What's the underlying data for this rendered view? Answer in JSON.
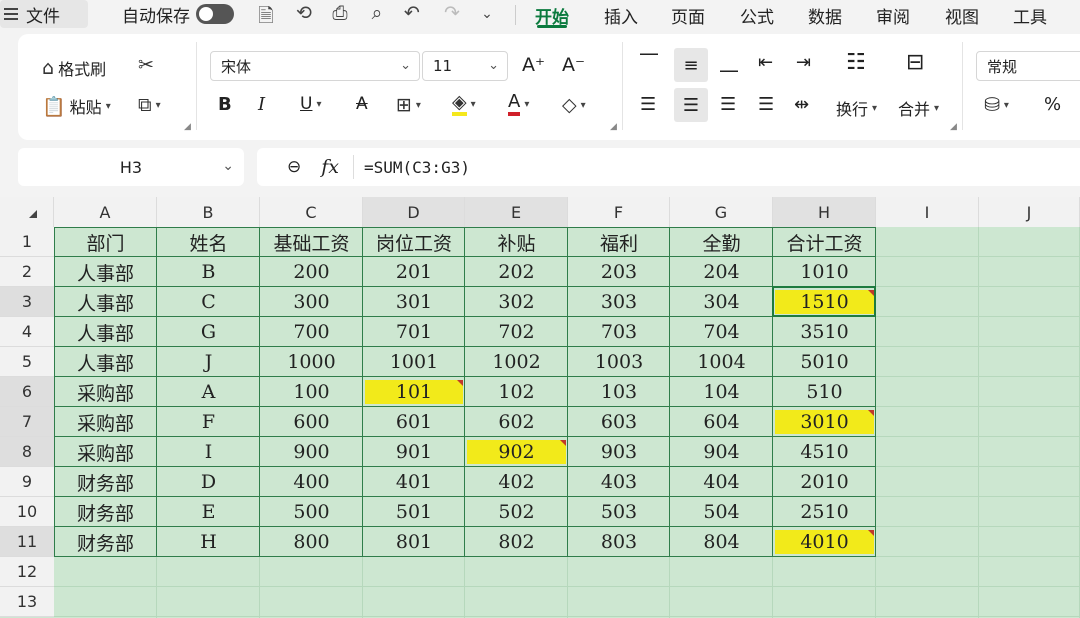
{
  "menubar": {
    "file": "文件",
    "autosave": "自动保存",
    "tabs": [
      "开始",
      "插入",
      "页面",
      "公式",
      "数据",
      "审阅",
      "视图",
      "工具"
    ],
    "active_tab": "开始"
  },
  "ribbon": {
    "format_painter": "格式刷",
    "paste": "粘贴",
    "font_name": "宋体",
    "font_size": "11",
    "wrap_text": "换行",
    "merge": "合并",
    "number_format": "常规",
    "percent": "%",
    "bold": "B",
    "italic": "I",
    "underline": "U",
    "font_color_letter": "A"
  },
  "formula_bar": {
    "name_box": "H3",
    "fx": "fx",
    "formula": "=SUM(C3:G3)"
  },
  "colors": {
    "accent": "#0b7a3e",
    "sheet_bg": "#cde7d1",
    "highlight": "#f2ea1a"
  },
  "sheet": {
    "columns": [
      "A",
      "B",
      "C",
      "D",
      "E",
      "F",
      "G",
      "H",
      "I",
      "J"
    ],
    "row_numbers": [
      "1",
      "2",
      "3",
      "4",
      "5",
      "6",
      "7",
      "8",
      "9",
      "10",
      "11",
      "12",
      "13"
    ],
    "selected_cell": "H3",
    "rows": [
      [
        "部门",
        "姓名",
        "基础工资",
        "岗位工资",
        "补贴",
        "福利",
        "全勤",
        "合计工资"
      ],
      [
        "人事部",
        "B",
        "200",
        "201",
        "202",
        "203",
        "204",
        "1010"
      ],
      [
        "人事部",
        "C",
        "300",
        "301",
        "302",
        "303",
        "304",
        "1510"
      ],
      [
        "人事部",
        "G",
        "700",
        "701",
        "702",
        "703",
        "704",
        "3510"
      ],
      [
        "人事部",
        "J",
        "1000",
        "1001",
        "1002",
        "1003",
        "1004",
        "5010"
      ],
      [
        "采购部",
        "A",
        "100",
        "101",
        "102",
        "103",
        "104",
        "510"
      ],
      [
        "采购部",
        "F",
        "600",
        "601",
        "602",
        "603",
        "604",
        "3010"
      ],
      [
        "采购部",
        "I",
        "900",
        "901",
        "902",
        "903",
        "904",
        "4510"
      ],
      [
        "财务部",
        "D",
        "400",
        "401",
        "402",
        "403",
        "404",
        "2010"
      ],
      [
        "财务部",
        "E",
        "500",
        "501",
        "502",
        "503",
        "504",
        "2510"
      ],
      [
        "财务部",
        "H",
        "800",
        "801",
        "802",
        "803",
        "804",
        "4010"
      ]
    ],
    "highlighted_cells": [
      "H3",
      "D6",
      "H7",
      "E8",
      "H11"
    ]
  }
}
